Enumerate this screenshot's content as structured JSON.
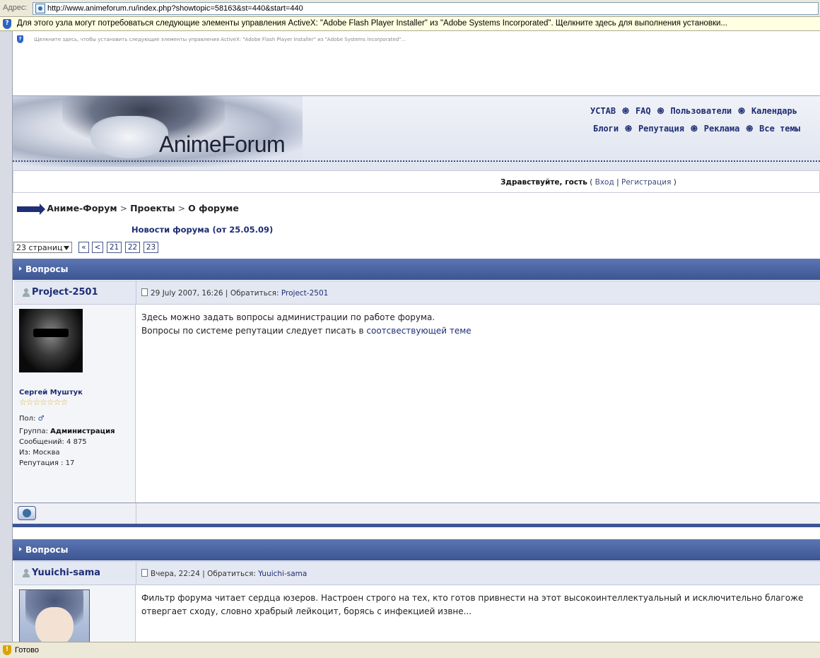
{
  "browser": {
    "address_label": "Адрес:",
    "url": "http://www.animeforum.ru/index.php?showtopic=58163&st=440&start=440",
    "infobar_text": "Для этого узла могут потребоваться следующие элементы управления ActiveX: \"Adobe Flash Player Installer\" из \"Adobe Systems Incorporated\". Щелкните здесь для выполнения установки...",
    "status_text": "Готово"
  },
  "page": {
    "activex_small": "Щелкните здесь, чтобы установить следующие элементы управления ActiveX: \"Adobe Flash Player Installer\" из \"Adobe Systems Incorporated\"...",
    "logo": "AnimeForum",
    "nav_row1": [
      "УСТАВ",
      "FAQ",
      "Пользователи",
      "Календарь"
    ],
    "nav_row2": [
      "Блоги",
      "Репутация",
      "Реклама",
      "Все темы"
    ],
    "guest": {
      "greeting": "Здравствуйте, гость",
      "open": "(",
      "login": "Вход",
      "divider": "|",
      "register": "Регистрация",
      "close": ")"
    },
    "breadcrumb": [
      "Аниме-Форум",
      "Проекты",
      "О форуме"
    ],
    "breadcrumb_sep": ">",
    "news_link": "Новости форума (от 25.05.09)",
    "pagination": {
      "select_value": "23 страниц",
      "buttons": [
        "«",
        "<",
        "21",
        "22",
        "23"
      ]
    }
  },
  "posts": [
    {
      "category": "Вопросы",
      "author": "Project-2501",
      "meta_date": "29 July 2007, 16:26",
      "meta_sep": "|",
      "meta_reply": "Обратиться:",
      "meta_reply_name": "Project-2501",
      "real_name": "Сергей Муштук",
      "stars": "☆☆☆☆☆☆☆",
      "gender_label": "Пол:",
      "gender_symbol": "♂",
      "group_label": "Группа:",
      "group_value": "Администрация",
      "messages": "Сообщений: 4 875",
      "from": "Из: Москва",
      "reputation": "Репутация : 17",
      "line1": "Здесь можно задать вопросы администрации по работе форума.",
      "line2_text": "Вопросы по системе репутации следует писать в",
      "line2_link": "соотсвествующей теме"
    },
    {
      "category": "Вопросы",
      "author": "Yuuichi-sama",
      "meta_date": "Вчера, 22:24",
      "meta_sep": "|",
      "meta_reply": "Обратиться:",
      "meta_reply_name": "Yuuichi-sama",
      "line1": "Фильтр форума читает сердца юзеров. Настроен строго на тех, кто готов привнести на этот высокоинтеллектуальный и исключительно благоже",
      "line2_text": "отвергает сходу, словно храбрый лейкоцит, борясь с инфекцией извне..."
    }
  ]
}
